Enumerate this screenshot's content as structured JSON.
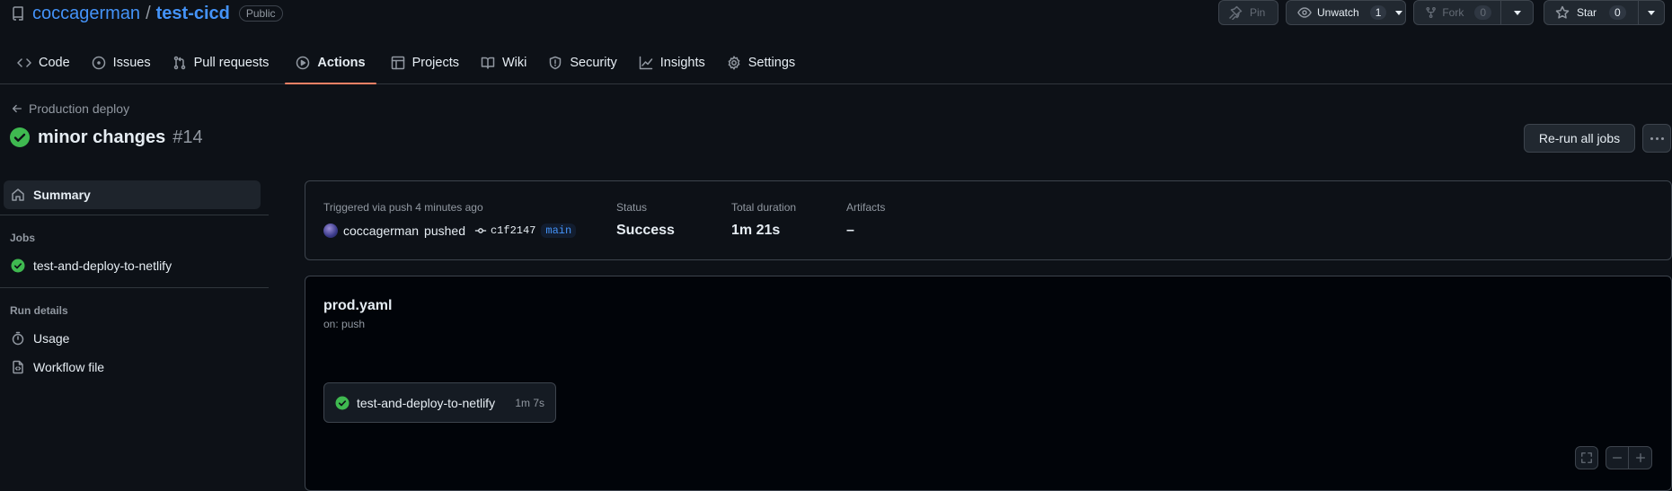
{
  "repo": {
    "owner": "coccagerman",
    "separator": "/",
    "name": "test-cicd",
    "visibility": "Public"
  },
  "header_buttons": {
    "pin": {
      "label": "Pin"
    },
    "unwatch": {
      "label": "Unwatch",
      "count": "1"
    },
    "fork": {
      "label": "Fork",
      "count": "0"
    },
    "star": {
      "label": "Star",
      "count": "0"
    }
  },
  "tabs": [
    {
      "label": "Code",
      "icon": "code-icon"
    },
    {
      "label": "Issues",
      "icon": "issue-icon"
    },
    {
      "label": "Pull requests",
      "icon": "pull-request-icon"
    },
    {
      "label": "Actions",
      "icon": "play-icon",
      "active": true
    },
    {
      "label": "Projects",
      "icon": "table-icon"
    },
    {
      "label": "Wiki",
      "icon": "book-icon"
    },
    {
      "label": "Security",
      "icon": "shield-icon"
    },
    {
      "label": "Insights",
      "icon": "graph-icon"
    },
    {
      "label": "Settings",
      "icon": "gear-icon"
    }
  ],
  "run": {
    "back_label": "Production deploy",
    "title": "minor changes",
    "number": "#14",
    "rerun_label": "Re-run all jobs"
  },
  "sidebar": {
    "summary_label": "Summary",
    "jobs_heading": "Jobs",
    "jobs": [
      {
        "label": "test-and-deploy-to-netlify"
      }
    ],
    "run_details_heading": "Run details",
    "details": [
      {
        "label": "Usage"
      },
      {
        "label": "Workflow file"
      }
    ]
  },
  "summary": {
    "trigger_text": "Triggered via push 4 minutes ago",
    "actor": "coccagerman",
    "action": "pushed",
    "commit": "c1f2147",
    "branch": "main",
    "status_label": "Status",
    "status_value": "Success",
    "duration_label": "Total duration",
    "duration_value": "1m 21s",
    "artifacts_label": "Artifacts",
    "artifacts_value": "–"
  },
  "workflow": {
    "file": "prod.yaml",
    "trigger": "on: push",
    "job": {
      "name": "test-and-deploy-to-netlify",
      "duration": "1m 7s"
    }
  },
  "colors": {
    "success": "#3fb950",
    "link": "#4493f8",
    "active_tab_underline": "#f78166"
  }
}
